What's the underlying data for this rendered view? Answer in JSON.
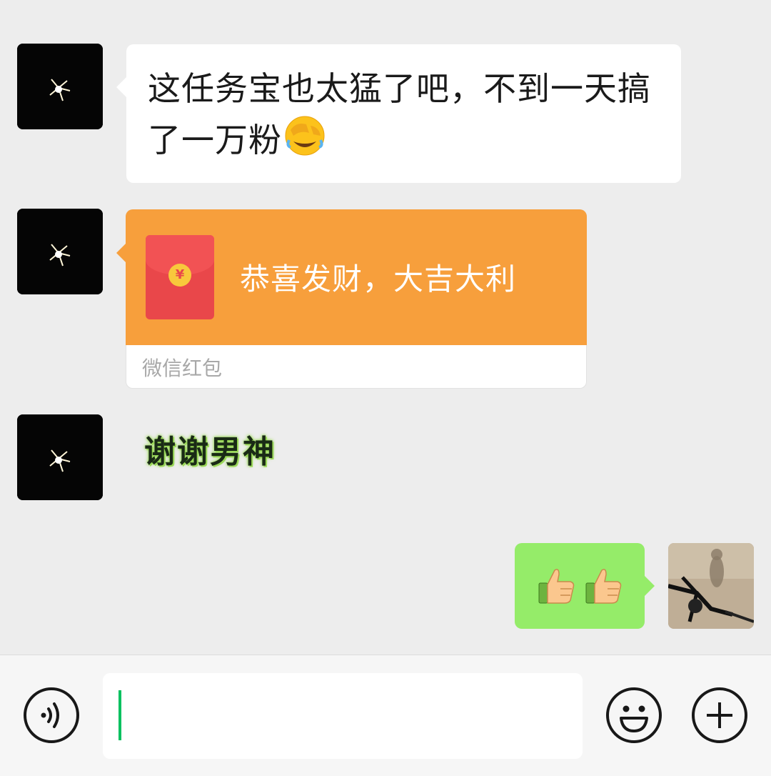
{
  "messages": [
    {
      "side": "left",
      "type": "text",
      "text": "这任务宝也太猛了吧，不到一天搞了一万粉",
      "emoji": "facepalm-laugh-emoji"
    },
    {
      "side": "left",
      "type": "red_packet",
      "title": "恭喜发财，大吉大利",
      "footer": "微信红包",
      "coin_symbol": "¥"
    },
    {
      "side": "left",
      "type": "sticker",
      "text": "谢谢男神"
    },
    {
      "side": "right",
      "type": "emoji",
      "emojis": [
        "thumbs-up-emoji",
        "thumbs-up-emoji"
      ]
    }
  ],
  "input": {
    "value": "",
    "placeholder": ""
  },
  "icons": {
    "voice": "voice-icon",
    "emoji": "smiley-icon",
    "more": "plus-icon"
  },
  "colors": {
    "background": "#ededed",
    "incoming_bubble": "#ffffff",
    "outgoing_bubble": "#95ec69",
    "red_packet": "#f79f3c",
    "caret": "#07c160"
  }
}
